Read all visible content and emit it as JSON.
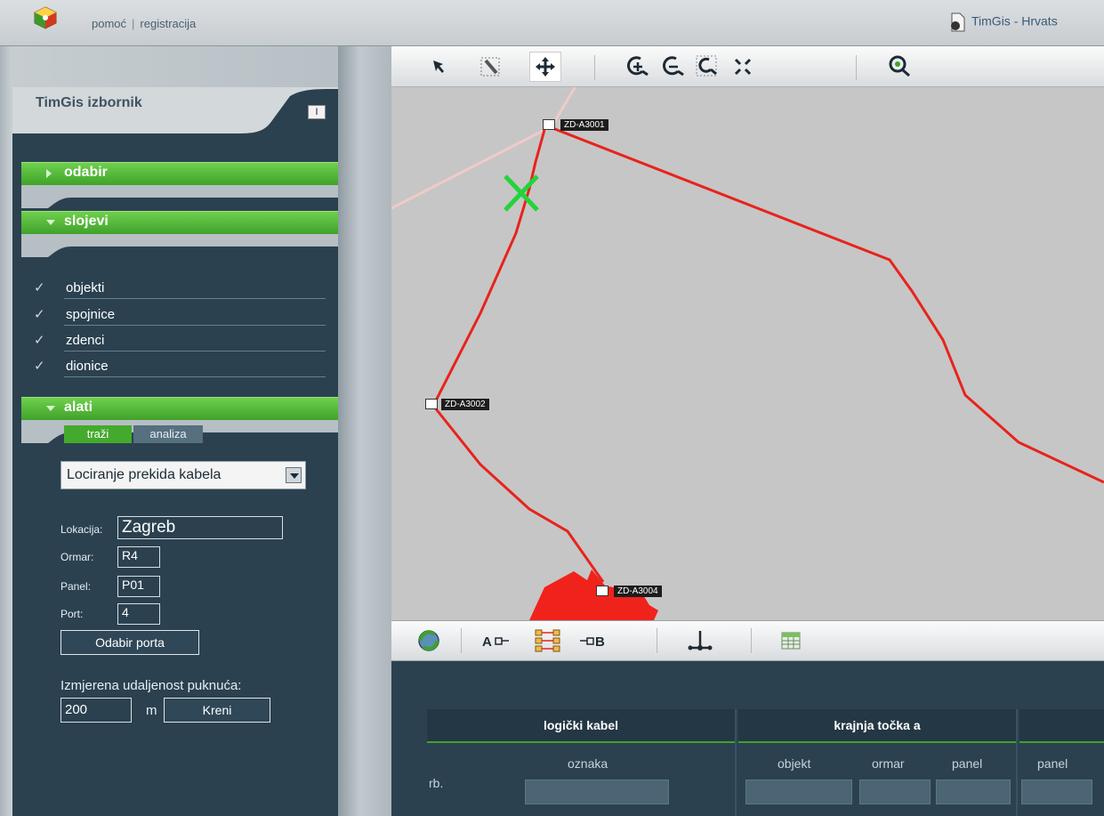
{
  "header": {
    "links": [
      "pomoć",
      "registracija"
    ],
    "separator": "|",
    "app_title": "TimGis - Hrvats"
  },
  "sidebar": {
    "title": "TimGis izbornik",
    "collapse_button": "I",
    "sections": {
      "odabir": "odabir",
      "slojevi": "slojevi",
      "alati": "alati"
    },
    "layers": [
      {
        "label": "objekti",
        "checked": true
      },
      {
        "label": "spojnice",
        "checked": true
      },
      {
        "label": "zdenci",
        "checked": true
      },
      {
        "label": "dionice",
        "checked": true
      }
    ],
    "tabs": [
      "traži",
      "analiza"
    ],
    "tool_select": "Lociranje prekida kabela",
    "fields": {
      "lokacija_label": "Lokacija:",
      "lokacija_value": "Zagreb",
      "ormar_label": "Ormar:",
      "ormar_value": "R4",
      "panel_label": "Panel:",
      "panel_value": "P01",
      "port_label": "Port:",
      "port_value": "4"
    },
    "port_button": "Odabir porta",
    "distance_label": "Izmjerena udaljenost puknuća:",
    "distance_value": "200",
    "distance_unit": "m",
    "go_button": "Kreni"
  },
  "map": {
    "nodes": [
      "ZD-A3001",
      "ZD-A3002",
      "ZD-A3004"
    ],
    "line_color": "#e8231c",
    "break_marker_color": "#22d43a"
  },
  "table": {
    "groups": [
      "logički kabel",
      "krajnja točka a"
    ],
    "columns": [
      "rb.",
      "oznaka",
      "objekt",
      "ormar",
      "panel",
      "panel"
    ]
  },
  "colors": {
    "accent_green": "#44aa2d",
    "panel_dark": "#2b4150"
  }
}
